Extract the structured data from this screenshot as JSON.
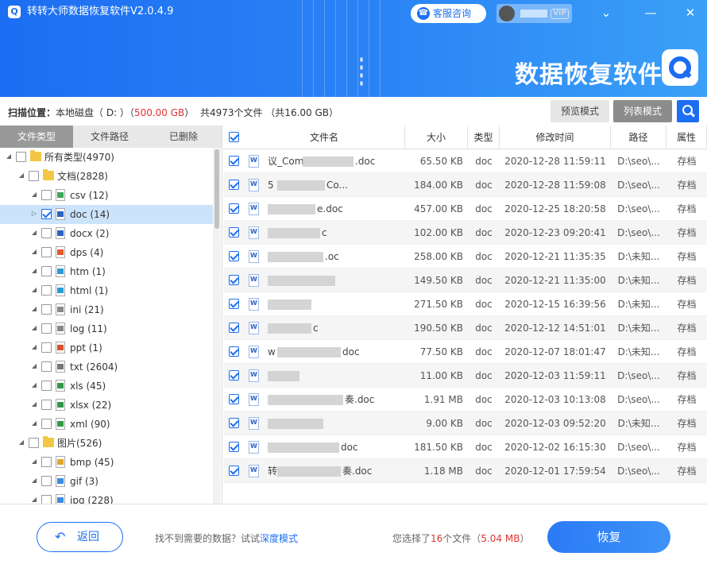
{
  "app": {
    "title": "转转大师数据恢复软件V2.0.4.9",
    "service_label": "客服咨询",
    "vip_label": "VIP",
    "brand_title": "数据恢复软件"
  },
  "scan": {
    "label": "扫描位置：",
    "location": "本地磁盘（ D: ）",
    "size_open": "（",
    "size": "500.00 GB",
    "size_close": "）",
    "total": "共4973个文件 （共16.00 GB）"
  },
  "modes": {
    "preview": "预览模式",
    "list": "列表模式"
  },
  "tabs": [
    "文件类型",
    "文件路径",
    "已删除"
  ],
  "tree": [
    {
      "label": "所有类型(4970)",
      "level": 0,
      "kind": "folder",
      "checked": false,
      "selected": false
    },
    {
      "label": "文档(2828)",
      "level": 1,
      "kind": "folder",
      "checked": false,
      "selected": false
    },
    {
      "label": "csv (12)",
      "level": 2,
      "kind": "csv",
      "checked": false,
      "selected": false
    },
    {
      "label": "doc (14)",
      "level": 2,
      "kind": "doc",
      "checked": true,
      "selected": true
    },
    {
      "label": "docx (2)",
      "level": 2,
      "kind": "docx",
      "checked": false,
      "selected": false
    },
    {
      "label": "dps (4)",
      "level": 2,
      "kind": "dps",
      "checked": false,
      "selected": false
    },
    {
      "label": "htm (1)",
      "level": 2,
      "kind": "htm",
      "checked": false,
      "selected": false
    },
    {
      "label": "html (1)",
      "level": 2,
      "kind": "html",
      "checked": false,
      "selected": false
    },
    {
      "label": "ini (21)",
      "level": 2,
      "kind": "ini",
      "checked": false,
      "selected": false
    },
    {
      "label": "log (11)",
      "level": 2,
      "kind": "log",
      "checked": false,
      "selected": false
    },
    {
      "label": "ppt (1)",
      "level": 2,
      "kind": "ppt",
      "checked": false,
      "selected": false
    },
    {
      "label": "txt (2604)",
      "level": 2,
      "kind": "txt",
      "checked": false,
      "selected": false
    },
    {
      "label": "xls (45)",
      "level": 2,
      "kind": "xls",
      "checked": false,
      "selected": false
    },
    {
      "label": "xlsx (22)",
      "level": 2,
      "kind": "xlsx",
      "checked": false,
      "selected": false
    },
    {
      "label": "xml (90)",
      "level": 2,
      "kind": "xml",
      "checked": false,
      "selected": false
    },
    {
      "label": "图片(526)",
      "level": 1,
      "kind": "folder",
      "checked": false,
      "selected": false
    },
    {
      "label": "bmp (45)",
      "level": 2,
      "kind": "bmp",
      "checked": false,
      "selected": false
    },
    {
      "label": "gif (3)",
      "level": 2,
      "kind": "gif",
      "checked": false,
      "selected": false
    },
    {
      "label": "jpg (228)",
      "level": 2,
      "kind": "jpg",
      "checked": false,
      "selected": false
    }
  ],
  "table": {
    "columns": [
      "文件名",
      "大小",
      "类型",
      "修改时间",
      "路径",
      "属性"
    ],
    "rows": [
      {
        "name": "议_Com",
        "name_suffix": ".doc",
        "size": "65.50 KB",
        "type": "doc",
        "mtime": "2020-12-28 11:59:11",
        "path": "D:\\seo\\...",
        "attr": "存档"
      },
      {
        "name": "5",
        "name_suffix": "Co...",
        "size": "184.00 KB",
        "type": "doc",
        "mtime": "2020-12-28 11:59:08",
        "path": "D:\\seo\\...",
        "attr": "存档"
      },
      {
        "name": "",
        "name_suffix": "e.doc",
        "size": "457.00 KB",
        "type": "doc",
        "mtime": "2020-12-25 18:20:58",
        "path": "D:\\seo\\...",
        "attr": "存档"
      },
      {
        "name": "",
        "name_suffix": "c",
        "size": "102.00 KB",
        "type": "doc",
        "mtime": "2020-12-23 09:20:41",
        "path": "D:\\seo\\...",
        "attr": "存档"
      },
      {
        "name": "",
        "name_suffix": ".oc",
        "size": "258.00 KB",
        "type": "doc",
        "mtime": "2020-12-21 11:35:35",
        "path": "D:\\未知...",
        "attr": "存档"
      },
      {
        "name": "",
        "name_suffix": "",
        "size": "149.50 KB",
        "type": "doc",
        "mtime": "2020-12-21 11:35:00",
        "path": "D:\\未知...",
        "attr": "存档"
      },
      {
        "name": "",
        "name_suffix": "",
        "size": "271.50 KB",
        "type": "doc",
        "mtime": "2020-12-15 16:39:56",
        "path": "D:\\未知...",
        "attr": "存档"
      },
      {
        "name": "",
        "name_suffix": "c",
        "size": "190.50 KB",
        "type": "doc",
        "mtime": "2020-12-12 14:51:01",
        "path": "D:\\未知...",
        "attr": "存档"
      },
      {
        "name": "w",
        "name_suffix": "doc",
        "size": "77.50 KB",
        "type": "doc",
        "mtime": "2020-12-07 18:01:47",
        "path": "D:\\未知...",
        "attr": "存档"
      },
      {
        "name": "",
        "name_suffix": "",
        "size": "11.00 KB",
        "type": "doc",
        "mtime": "2020-12-03 11:59:11",
        "path": "D:\\seo\\...",
        "attr": "存档"
      },
      {
        "name": "",
        "name_suffix": "奏.doc",
        "size": "1.91 MB",
        "type": "doc",
        "mtime": "2020-12-03 10:13:08",
        "path": "D:\\seo\\...",
        "attr": "存档"
      },
      {
        "name": "",
        "name_suffix": "",
        "size": "9.00 KB",
        "type": "doc",
        "mtime": "2020-12-03 09:52:20",
        "path": "D:\\未知...",
        "attr": "存档"
      },
      {
        "name": "",
        "name_suffix": "doc",
        "size": "181.50 KB",
        "type": "doc",
        "mtime": "2020-12-02 16:15:30",
        "path": "D:\\seo\\...",
        "attr": "存档"
      },
      {
        "name": "转",
        "name_suffix": "奏.doc",
        "size": "1.18 MB",
        "type": "doc",
        "mtime": "2020-12-01 17:59:54",
        "path": "D:\\seo\\...",
        "attr": "存档"
      }
    ]
  },
  "footer": {
    "back_label": "返回",
    "hint_text": "找不到需要的数据？试试",
    "deep_mode": "深度模式",
    "sel_prefix": "您选择了",
    "sel_count": "16",
    "sel_mid": "个文件（",
    "sel_size": "5.04 MB",
    "sel_suffix": "）",
    "recover_label": "恢复"
  },
  "colors": {
    "accent": "#1c6ef2",
    "red": "#e03131"
  },
  "icons": {
    "service": "headset-icon",
    "minimize": "minimize-icon",
    "menu": "chevron-down-icon",
    "close": "close-icon",
    "search": "search-icon",
    "back": "back-arrow-icon"
  }
}
